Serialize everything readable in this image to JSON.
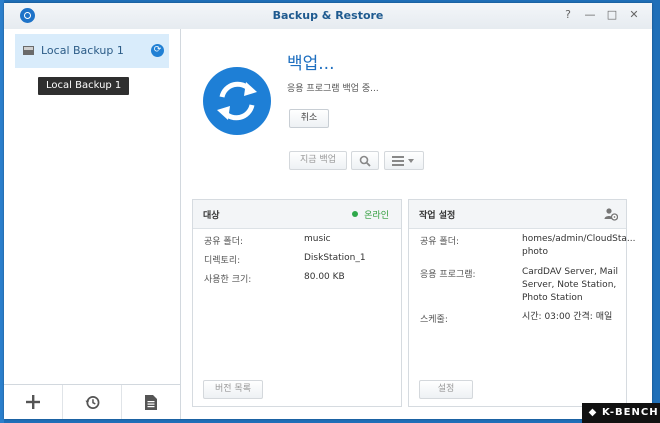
{
  "window": {
    "title": "Backup & Restore",
    "controls": [
      "?",
      "—",
      "□",
      "✕"
    ]
  },
  "sidebar": {
    "task_label": "Local Backup 1",
    "tooltip": "Local Backup 1",
    "bottom_buttons": [
      "add-icon",
      "history-icon",
      "log-icon"
    ]
  },
  "header": {
    "title": "백업...",
    "subtitle": "응용 프로그램 백업 중...",
    "cancel_label": "취소"
  },
  "toolbar": {
    "backup_now_label": "지금 백업",
    "search_icon": "search-icon",
    "menu_icon": "list-icon"
  },
  "target_panel": {
    "title": "대상",
    "status": "온라인",
    "rows": [
      {
        "label": "공유 폴더:",
        "value": "music"
      },
      {
        "label": "디렉토리:",
        "value": "DiskStation_1"
      },
      {
        "label": "사용한 크기:",
        "value": "80.00 KB"
      }
    ],
    "button_label": "버전 목록"
  },
  "task_panel": {
    "title": "작업 설정",
    "rows": [
      {
        "label": "공유 폴더:",
        "value": "homes/admin/CloudSta...\nphoto"
      },
      {
        "label": "응용 프로그램:",
        "value": "CardDAV Server, Mail\nServer, Note Station,\nPhoto Station"
      },
      {
        "label": "스케줄:",
        "value": "시간: 03:00 간격: 매일"
      }
    ],
    "button_label": "설정"
  },
  "colors": {
    "accent": "#1e7fd6",
    "online": "#2ea84a",
    "desktop": "#1f6fb8"
  },
  "watermark": "K-BENCH"
}
